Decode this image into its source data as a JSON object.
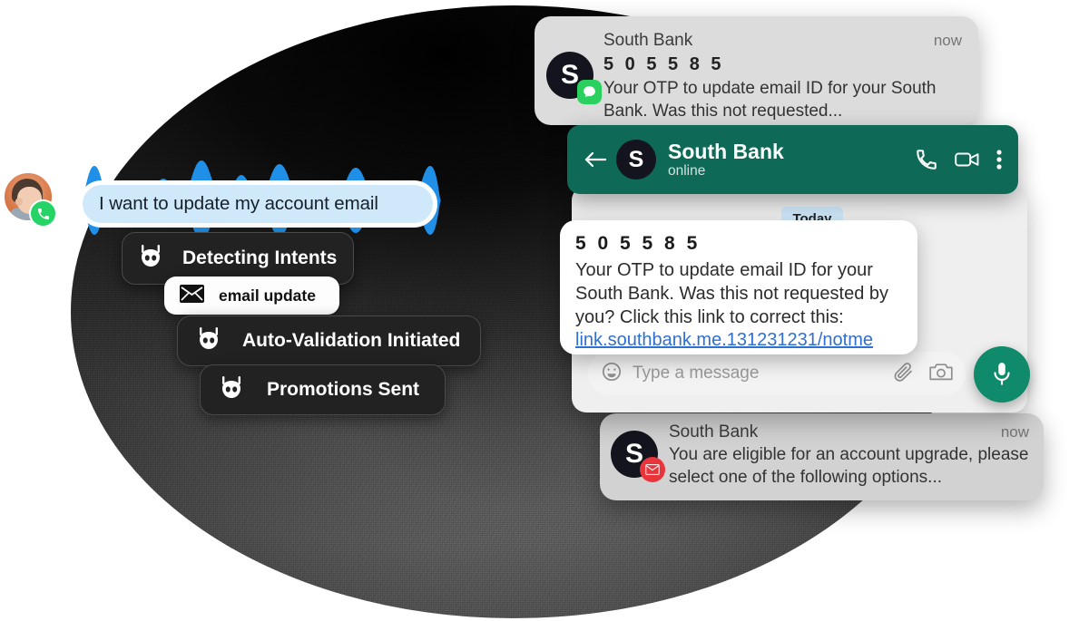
{
  "background": {
    "circle_color": "#2a2a2a",
    "texture": "grain"
  },
  "voice": {
    "avatar_name": "user-avatar",
    "badge_icon": "whatsapp-phone-icon",
    "transcript": "I want to update my account email",
    "bubble_color": "#cfe9fb",
    "waveform_color": "#1f8fe8"
  },
  "chips": [
    {
      "icon": "robot-icon",
      "label": "Detecting Intents",
      "style": "dark"
    },
    {
      "icon": "envelope-icon",
      "label": "email update",
      "style": "light"
    },
    {
      "icon": "robot-icon",
      "label": "Auto-Validation Initiated",
      "style": "dark"
    },
    {
      "icon": "robot-icon",
      "label": "Promotions Sent",
      "style": "dark"
    }
  ],
  "notification_top": {
    "avatar_letter": "S",
    "badge_icon": "whatsapp-chat-icon",
    "app": "South Bank",
    "time": "now",
    "otp": "5 0 5 5 8 5",
    "body": "Your OTP to update email ID for your South Bank. Was this not requested..."
  },
  "whatsapp": {
    "back_icon": "arrow-left-icon",
    "avatar_letter": "S",
    "contact": "South Bank",
    "status": "online",
    "call_icon": "phone-icon",
    "video_icon": "video-camera-icon",
    "menu_icon": "overflow-menu-icon",
    "header_color": "#0e6a57",
    "date_divider": "Today",
    "message": {
      "otp": "5 0 5 5 8 5",
      "text": "Your OTP to update email ID for your South Bank. Was this not requested by you? Click this link to correct this:",
      "link": "link.southbank.me.131231231/notme",
      "link_color": "#2f6fd0"
    },
    "input": {
      "emoji_icon": "emoji-smiley-icon",
      "placeholder": "Type a message",
      "attach_icon": "paperclip-icon",
      "camera_icon": "camera-icon",
      "mic_icon": "microphone-icon",
      "mic_color": "#0f8a6a"
    }
  },
  "notification_bottom": {
    "avatar_letter": "S",
    "badge_icon": "mail-alert-icon",
    "app": "South Bank",
    "time": "now",
    "body": "You are eligible for an account upgrade, please select one of the following options..."
  }
}
